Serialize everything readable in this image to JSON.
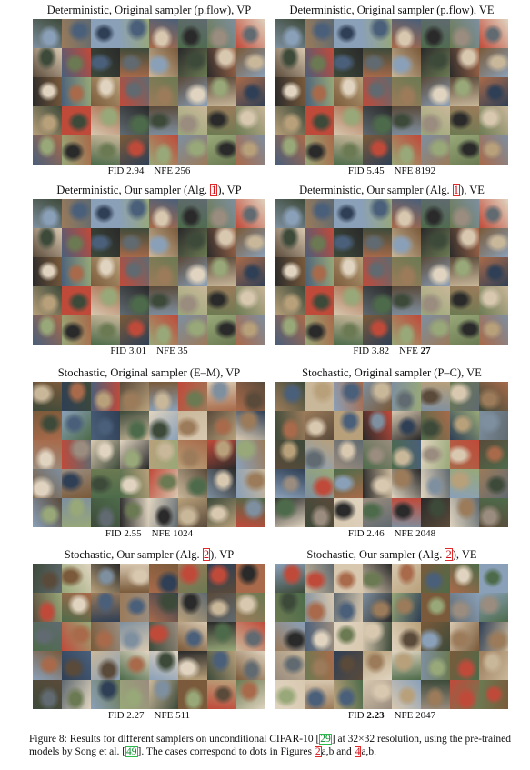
{
  "panels": [
    {
      "id": "det-orig-vp",
      "title_pre": "Deterministic, Original sampler (p.flow), VP",
      "title_ref": "",
      "title_post": "",
      "fid_label": "FID",
      "fid": "2.94",
      "fid_bold": false,
      "nfe_label": "NFE",
      "nfe": "256",
      "nfe_bold": false,
      "seed": 11
    },
    {
      "id": "det-orig-ve",
      "title_pre": "Deterministic, Original sampler (p.flow), VE",
      "title_ref": "",
      "title_post": "",
      "fid_label": "FID",
      "fid": "5.45",
      "fid_bold": false,
      "nfe_label": "NFE",
      "nfe": "8192",
      "nfe_bold": false,
      "seed": 11
    },
    {
      "id": "det-our-vp",
      "title_pre": "Deterministic, Our sampler (Alg. ",
      "title_ref": "1",
      "title_post": "), VP",
      "fid_label": "FID",
      "fid": "3.01",
      "fid_bold": false,
      "nfe_label": "NFE",
      "nfe": "35",
      "nfe_bold": false,
      "seed": 11
    },
    {
      "id": "det-our-ve",
      "title_pre": "Deterministic, Our sampler (Alg. ",
      "title_ref": "1",
      "title_post": "), VE",
      "fid_label": "FID",
      "fid": "3.82",
      "fid_bold": false,
      "nfe_label": "NFE",
      "nfe": "27",
      "nfe_bold": true,
      "seed": 11
    },
    {
      "id": "sto-orig-vp",
      "title_pre": "Stochastic, Original sampler (E–M), VP",
      "title_ref": "",
      "title_post": "",
      "fid_label": "FID",
      "fid": "2.55",
      "fid_bold": false,
      "nfe_label": "NFE",
      "nfe": "1024",
      "nfe_bold": false,
      "seed": 37
    },
    {
      "id": "sto-orig-ve",
      "title_pre": "Stochastic, Original sampler (P–C), VE",
      "title_ref": "",
      "title_post": "",
      "fid_label": "FID",
      "fid": "2.46",
      "fid_bold": false,
      "nfe_label": "NFE",
      "nfe": "2048",
      "nfe_bold": false,
      "seed": 53
    },
    {
      "id": "sto-our-vp",
      "title_pre": "Stochastic, Our sampler (Alg. ",
      "title_ref": "2",
      "title_post": "), VP",
      "fid_label": "FID",
      "fid": "2.27",
      "fid_bold": false,
      "nfe_label": "NFE",
      "nfe": "511",
      "nfe_bold": false,
      "seed": 71
    },
    {
      "id": "sto-our-ve",
      "title_pre": "Stochastic, Our sampler (Alg. ",
      "title_ref": "2",
      "title_post": "), VE",
      "fid_label": "FID",
      "fid": "2.23",
      "fid_bold": true,
      "nfe_label": "NFE",
      "nfe": "2047",
      "nfe_bold": false,
      "seed": 89
    }
  ],
  "caption": {
    "p1": "Figure 8: Results for different samplers on unconditional CIFAR-10 [",
    "ref1": "29",
    "p2": "] at 32×32 resolution, using the pre-trained models by Song et al. [",
    "ref2": "49",
    "p3": "]. The cases correspond to dots in Figures ",
    "ref3": "2",
    "p4": "a,b and ",
    "ref4": "4",
    "p5": "a,b."
  },
  "palette": [
    "#6b7a52",
    "#9b7b5a",
    "#4a5f7a",
    "#c9b79a",
    "#7e8f9f",
    "#3d4a3a",
    "#a86a4a",
    "#8aa0b8",
    "#5a4a3a",
    "#b8a07a",
    "#2f3f55",
    "#d8c8b0",
    "#7a5a3a",
    "#98a878",
    "#606a70",
    "#c04a3a",
    "#4d6b4a",
    "#9a8c7e",
    "#e0d4c0",
    "#2a2a2a"
  ]
}
